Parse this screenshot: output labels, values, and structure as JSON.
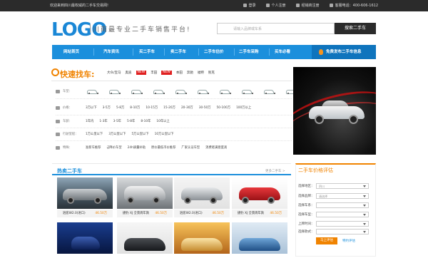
{
  "topbar": {
    "welcome": "欢迎来到四川最权威的二手车交易网!",
    "links": [
      {
        "label": "登录",
        "icon": "user-icon"
      },
      {
        "label": "个人注册",
        "icon": "person-icon"
      },
      {
        "label": "经销商注册",
        "icon": "dealer-icon"
      },
      {
        "label": "客服电话：400-606-1612",
        "icon": "phone-icon"
      }
    ]
  },
  "header": {
    "logo": "LOGO",
    "slogan": "川南最专业二手车销售平台!",
    "search_placeholder": "请输入品牌或车系",
    "search_button": "搜索二手车"
  },
  "nav": {
    "items": [
      "网站首页",
      "汽车资讯",
      "买二手车",
      "卖二手车",
      "二手车估价",
      "二手车采购",
      "买车必看"
    ],
    "hot": "免费发布二手车信息"
  },
  "quick_find": {
    "title": "快速找车:",
    "brands": [
      "大众/宝马",
      "奥迪",
      "丰田",
      "本田",
      "奔驰",
      "福特",
      "别克"
    ],
    "new_badge": "NEW",
    "rows": [
      {
        "label": "车型：",
        "options": []
      },
      {
        "label": "价格：",
        "options": [
          "3万以下",
          "3-5万",
          "5-8万",
          "8-10万",
          "10-15万",
          "15-20万",
          "20-30万",
          "30-50万",
          "50-100万",
          "100万以上"
        ]
      },
      {
        "label": "车龄：",
        "options": [
          "1年内",
          "1-3年",
          "3-5年",
          "5-8年",
          "8-10年",
          "10年以上"
        ]
      },
      {
        "label": "行驶里程：",
        "options": [
          "1万公里以下",
          "3万公里以下",
          "5万公里以下",
          "10万公里以下"
        ]
      },
      {
        "label": "特殊：",
        "options": [
          "准新车推荐",
          "급降价车型",
          "24h质量补贴",
          "原价最低市价推荐",
          "厂家认证车型",
          "消费者满意度高"
        ]
      }
    ]
  },
  "hot_section": {
    "title": "热卖二手车",
    "more": "更多二手车 >"
  },
  "cards": [
    {
      "name": "逍客W2.0(进口)",
      "price": "46.50万"
    },
    {
      "name": "捷豹 XJ 全景周年款",
      "price": "46.50万"
    },
    {
      "name": "逍客W2.0(进口)",
      "price": "46.50万"
    },
    {
      "name": "捷豹 XJ 全景周年款",
      "price": "46.50万"
    }
  ],
  "valuation": {
    "title": "二手车价格评估",
    "fields": [
      {
        "label": "选择地区：",
        "value": "四川"
      },
      {
        "label": "选择品牌：",
        "value": "请选择"
      },
      {
        "label": "选择车系：",
        "value": ""
      },
      {
        "label": "选择车型：",
        "value": ""
      },
      {
        "label": "上牌时间：",
        "value": ""
      },
      {
        "label": "选择款式：",
        "value": ""
      }
    ],
    "button": "马上评估",
    "link": "特约评估"
  },
  "colors": {
    "accent": "#1b8fdc",
    "orange": "#f08300",
    "dark": "#2b2b2b"
  }
}
